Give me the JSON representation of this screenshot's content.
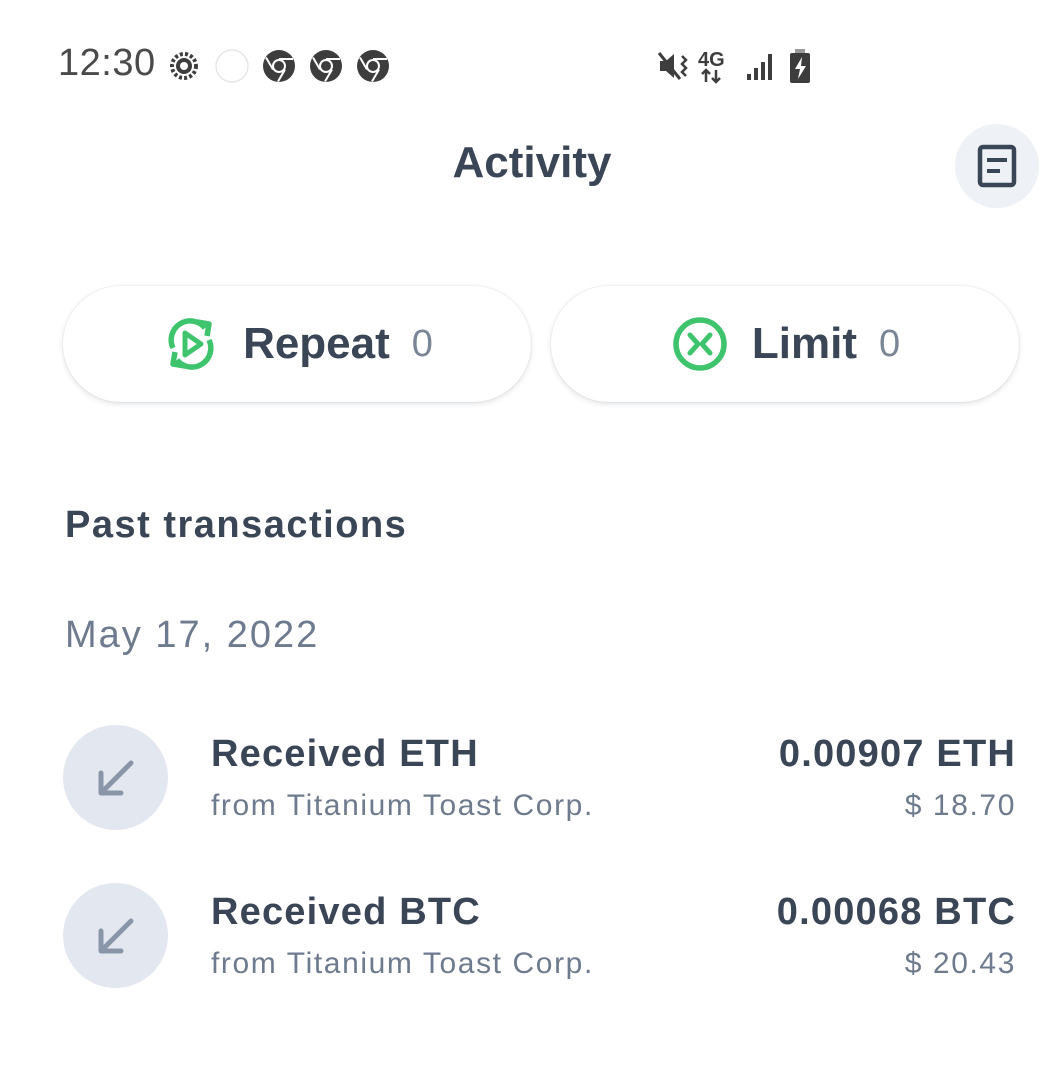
{
  "status_bar": {
    "time": "12:30",
    "left_icons": [
      "settings-gear-icon",
      "circle-icon",
      "chrome-icon",
      "chrome-icon",
      "chrome-icon"
    ],
    "right_icons": [
      "mute-vibrate-icon",
      "4g-lte-icon",
      "signal-icon",
      "battery-charging-icon"
    ],
    "network_label": "4G"
  },
  "header": {
    "title": "Activity",
    "action_icon": "receipt-icon"
  },
  "pills": [
    {
      "label": "Repeat",
      "count": "0",
      "icon": "repeat-icon"
    },
    {
      "label": "Limit",
      "count": "0",
      "icon": "limit-icon"
    }
  ],
  "section_title": "Past transactions",
  "groups": [
    {
      "date": "May 17, 2022",
      "transactions": [
        {
          "title": "Received ETH",
          "subtitle": "from Titanium Toast Corp.",
          "amount": "0.00907 ETH",
          "fiat": "$ 18.70",
          "icon": "arrow-down-left-icon"
        },
        {
          "title": "Received BTC",
          "subtitle": "from Titanium Toast Corp.",
          "amount": "0.00068 BTC",
          "fiat": "$ 20.43",
          "icon": "arrow-down-left-icon"
        }
      ]
    }
  ],
  "colors": {
    "accent_green": "#3ec46d",
    "text_primary": "#3a4556",
    "text_secondary": "#6e7a8d",
    "avatar_bg": "#e3e8f0",
    "icon_button_bg": "#eef1f6"
  }
}
